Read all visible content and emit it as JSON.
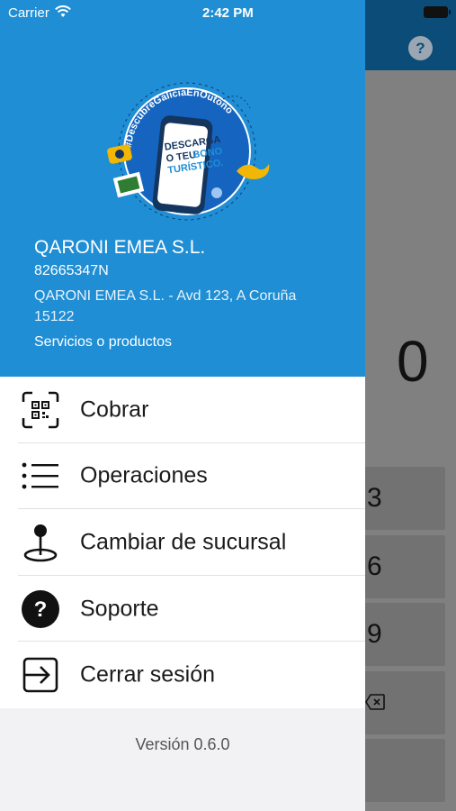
{
  "status_bar": {
    "carrier": "Carrier",
    "time": "2:42 PM"
  },
  "background": {
    "help_label": "?",
    "amount": "0",
    "keys": [
      "3",
      "6",
      "9",
      ""
    ]
  },
  "drawer": {
    "banner": {
      "hashtag": "#DescubreGaliciaEnOutono",
      "line1": "DESCARGA",
      "line2": "O TEU",
      "line2b": "BONO",
      "line3": "TURÍSTICO."
    },
    "company": {
      "name": "QARONI EMEA S.L.",
      "id": "82665347N",
      "address": "QARONI EMEA S.L. - Avd 123, A Coruña 15122",
      "services": "Servicios o productos"
    },
    "menu": [
      {
        "label": "Cobrar",
        "icon": "qr-code-icon"
      },
      {
        "label": "Operaciones",
        "icon": "list-icon"
      },
      {
        "label": "Cambiar de sucursal",
        "icon": "map-pin-icon"
      },
      {
        "label": "Soporte",
        "icon": "question-circle-icon"
      },
      {
        "label": "Cerrar sesión",
        "icon": "logout-icon"
      }
    ],
    "version": "Versión 0.6.0"
  },
  "colors": {
    "drawer_header": "#1f8ed4",
    "app_header": "#0b4d78",
    "overlay": "#808080"
  }
}
